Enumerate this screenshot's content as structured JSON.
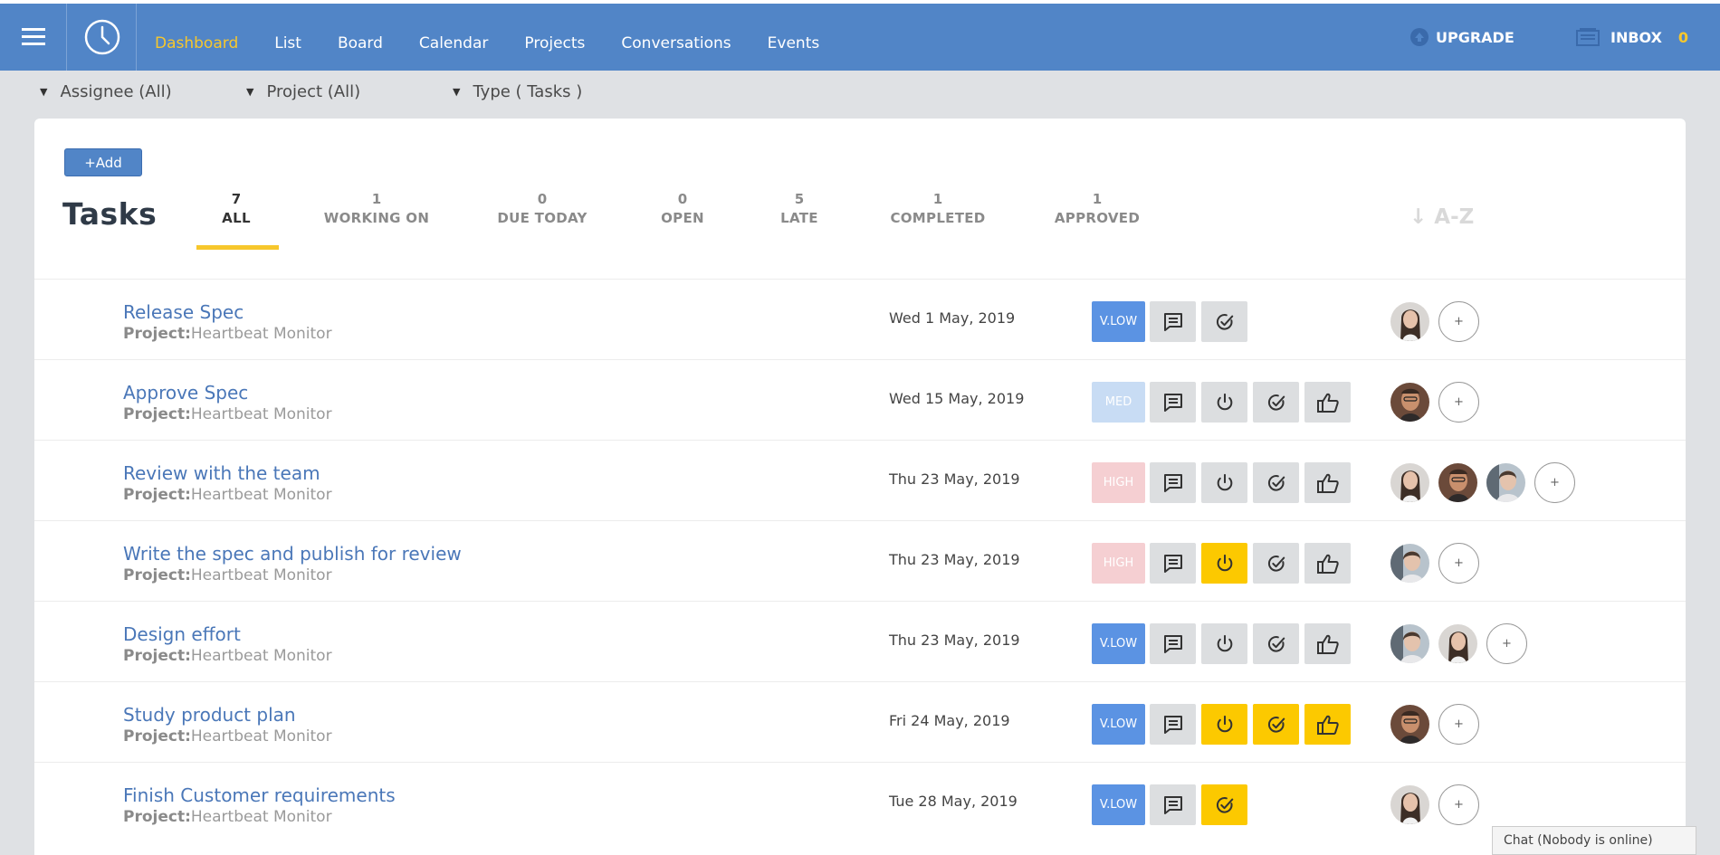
{
  "nav": {
    "items": [
      "Dashboard",
      "List",
      "Board",
      "Calendar",
      "Projects",
      "Conversations",
      "Events"
    ],
    "active": "Dashboard",
    "upgrade_label": "UPGRADE",
    "inbox_label": "INBOX",
    "inbox_count": "0"
  },
  "filters": {
    "assignee": "Assignee (All)",
    "project": "Project (All)",
    "type": "Type ( Tasks )"
  },
  "add_label": "+Add",
  "title": "Tasks",
  "tabs": [
    {
      "count": "7",
      "label": "ALL",
      "active": true
    },
    {
      "count": "1",
      "label": "WORKING ON"
    },
    {
      "count": "0",
      "label": "DUE TODAY"
    },
    {
      "count": "0",
      "label": "OPEN"
    },
    {
      "count": "5",
      "label": "LATE"
    },
    {
      "count": "1",
      "label": "COMPLETED"
    },
    {
      "count": "1",
      "label": "APPROVED"
    }
  ],
  "sort_label": "↓ A-Z",
  "project_prefix": "Project:",
  "tasks": [
    {
      "name": "Release Spec",
      "project": "Heartbeat Monitor",
      "date": "Wed 1 May, 2019",
      "priority": "V.LOW",
      "buttons": [
        "comment",
        "check"
      ],
      "active": [],
      "avatars": [
        "woman-a"
      ]
    },
    {
      "name": "Approve Spec",
      "project": "Heartbeat Monitor",
      "date": "Wed 15 May, 2019",
      "priority": "MED",
      "buttons": [
        "comment",
        "power",
        "check",
        "thumb"
      ],
      "active": [],
      "avatars": [
        "man-a"
      ]
    },
    {
      "name": "Review with the team",
      "project": "Heartbeat Monitor",
      "date": "Thu 23 May, 2019",
      "priority": "HIGH",
      "buttons": [
        "comment",
        "power",
        "check",
        "thumb"
      ],
      "active": [],
      "avatars": [
        "woman-a",
        "man-a",
        "woman-b"
      ]
    },
    {
      "name": "Write the spec and publish for review",
      "project": "Heartbeat Monitor",
      "date": "Thu 23 May, 2019",
      "priority": "HIGH",
      "buttons": [
        "comment",
        "power",
        "check",
        "thumb"
      ],
      "active": [
        "power"
      ],
      "avatars": [
        "woman-b"
      ]
    },
    {
      "name": "Design effort",
      "project": "Heartbeat Monitor",
      "date": "Thu 23 May, 2019",
      "priority": "V.LOW",
      "buttons": [
        "comment",
        "power",
        "check",
        "thumb"
      ],
      "active": [],
      "avatars": [
        "woman-b",
        "woman-a"
      ]
    },
    {
      "name": "Study product plan",
      "project": "Heartbeat Monitor",
      "date": "Fri 24 May, 2019",
      "priority": "V.LOW",
      "buttons": [
        "comment",
        "power",
        "check",
        "thumb"
      ],
      "active": [
        "power",
        "check",
        "thumb"
      ],
      "avatars": [
        "man-a"
      ]
    },
    {
      "name": "Finish Customer requirements",
      "project": "Heartbeat Monitor",
      "date": "Tue 28 May, 2019",
      "priority": "V.LOW",
      "buttons": [
        "comment",
        "check"
      ],
      "active": [
        "check"
      ],
      "avatars": [
        "woman-a"
      ]
    }
  ],
  "add_assignee_label": "+",
  "chat_label": "Chat (Nobody is online)",
  "colors": {
    "header": "#5185c7",
    "active": "#f7c72c",
    "accent": "#fcc900",
    "vlow": "#5b93e3"
  }
}
